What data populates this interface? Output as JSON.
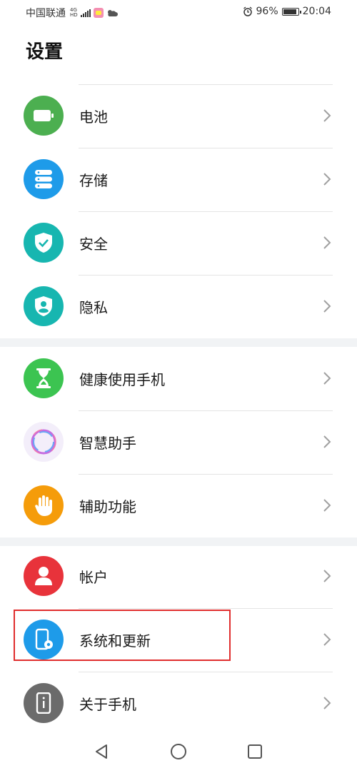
{
  "status_bar": {
    "carrier": "中国联通",
    "network_top": "4G",
    "network_bottom": "HD",
    "alarm_icon": "alarm-icon",
    "battery_percent": "96%",
    "time": "20:04"
  },
  "title": "设置",
  "groups": [
    {
      "items": [
        {
          "label": "电池",
          "icon": "battery-icon",
          "color": "#4caf50"
        },
        {
          "label": "存储",
          "icon": "storage-icon",
          "color": "#1e9be9"
        },
        {
          "label": "安全",
          "icon": "shield-check-icon",
          "color": "#17b6b0"
        },
        {
          "label": "隐私",
          "icon": "privacy-icon",
          "color": "#17b6b0"
        }
      ]
    },
    {
      "items": [
        {
          "label": "健康使用手机",
          "icon": "hourglass-icon",
          "color": "#3cc451"
        },
        {
          "label": "智慧助手",
          "icon": "assistant-ring-icon",
          "color": "#f3eefa"
        },
        {
          "label": "辅助功能",
          "icon": "hand-icon",
          "color": "#f59c0a"
        }
      ]
    },
    {
      "items": [
        {
          "label": "帐户",
          "icon": "account-icon",
          "color": "#e8333b"
        },
        {
          "label": "系统和更新",
          "icon": "phone-settings-icon",
          "color": "#1e9be9"
        },
        {
          "label": "关于手机",
          "icon": "phone-info-icon",
          "color": "#6b6b6b"
        }
      ]
    }
  ],
  "highlight_color": "#e02d2d",
  "nav": {
    "back": "back-icon",
    "home": "home-icon",
    "recents": "recents-icon"
  }
}
